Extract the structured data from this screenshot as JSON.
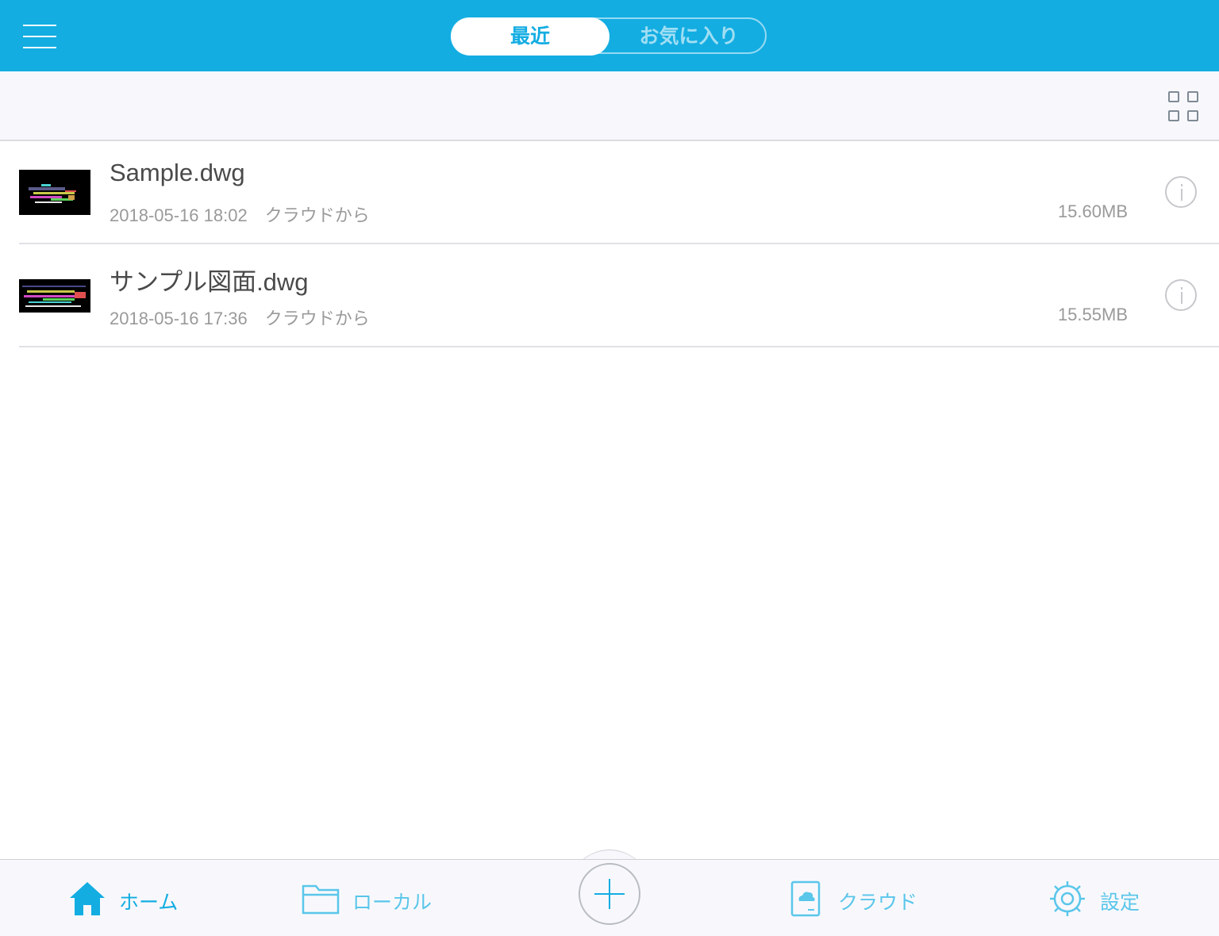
{
  "header": {
    "tabs": [
      {
        "label": "最近",
        "active": true
      },
      {
        "label": "お気に入り",
        "active": false
      }
    ]
  },
  "toolbar": {
    "view_toggle_icon": "grid-view-icon"
  },
  "files": [
    {
      "name": "Sample.dwg",
      "date": "2018-05-16 18:02",
      "source": "クラウドから",
      "size": "15.60MB"
    },
    {
      "name": "サンプル図面.dwg",
      "date": "2018-05-16 17:36",
      "source": "クラウドから",
      "size": "15.55MB"
    }
  ],
  "tabbar": {
    "home": "ホーム",
    "local": "ローカル",
    "cloud": "クラウド",
    "settings": "設定"
  },
  "colors": {
    "accent": "#13ade2",
    "accent_light": "#5ac6ea",
    "toolbar_bg": "#f8f8fc"
  }
}
